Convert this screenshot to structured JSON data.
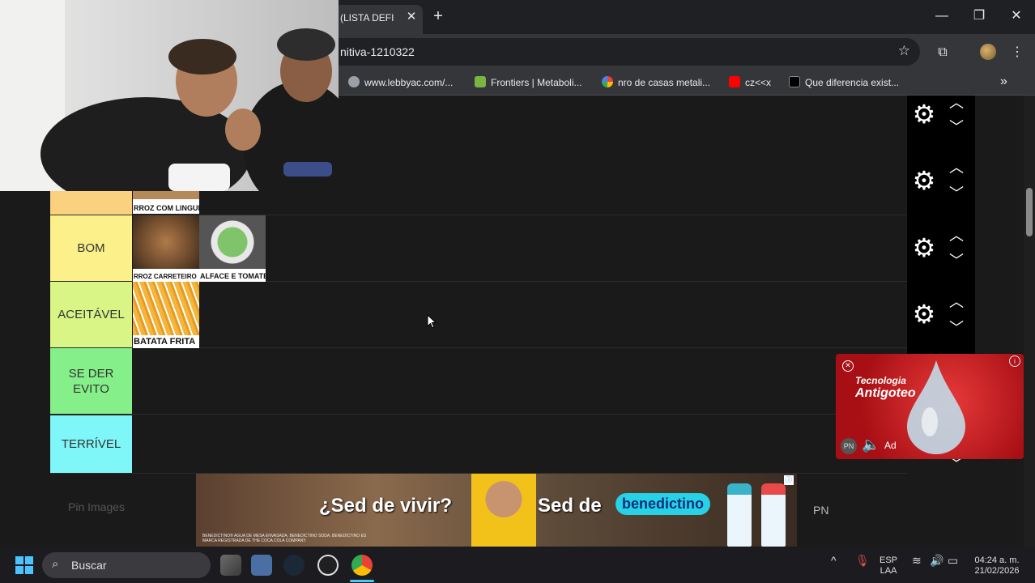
{
  "browser": {
    "tab_title": "(LISTA DEFI",
    "tab_close": "✕",
    "new_tab": "+",
    "url": "nitiva-1210322",
    "bookmarks": [
      {
        "label": "www.lebbyac.com/...",
        "color": "#9aa0a6"
      },
      {
        "label": "Frontiers | Metaboli...",
        "color": "#7cb342"
      },
      {
        "label": "nro de casas metali...",
        "color": "#4285f4"
      },
      {
        "label": "cz<<x",
        "color": "#ff0000"
      },
      {
        "label": "Que diferencia exist...",
        "color": "#202124"
      }
    ],
    "window": {
      "minimize": "—",
      "maximize": "❐",
      "close": "✕"
    },
    "more_bookmarks": "»"
  },
  "tiers": [
    {
      "label": "",
      "color": "#fad27f"
    },
    {
      "label": "BOM",
      "color": "#fbf08a"
    },
    {
      "label": "ACEITÁVEL",
      "color": "#d8f586"
    },
    {
      "label": "SE DER EVITO",
      "color": "#85f08a"
    },
    {
      "label": "TERRÍVEL",
      "color": "#7ff6f8"
    }
  ],
  "items": {
    "arroz_linguica": "RROZ COM LINGUIÇ",
    "arroz_carreteiro": "RROZ CARRETEIRO",
    "alface_tomate": "ALFACE E TOMATE",
    "batata_frita": "BATATA FRITA"
  },
  "ads": {
    "side_title_1": "Tecnologia",
    "side_title_2": "Antigoteo",
    "side_ad_label": "Ad",
    "side_pn": "PN",
    "bottom_headline_1": "¿Sed de vivir?",
    "bottom_headline_2": "Sed de",
    "bottom_brand": "benedictino",
    "bottom_fineprint": "BENEDICTINO® AGUA DE MESA ENVASADA. BENEDICTINO SODA. BENEDICTINO ES MARCA REGISTRADA DE THE COCA COLA COMPANY.",
    "pn": "PN",
    "pin_images": "Pin Images"
  },
  "taskbar": {
    "search_label": "Buscar",
    "lang_1": "ESP",
    "lang_2": "LAA",
    "time": "04:24 a. m.",
    "date": "21/02/2026"
  }
}
